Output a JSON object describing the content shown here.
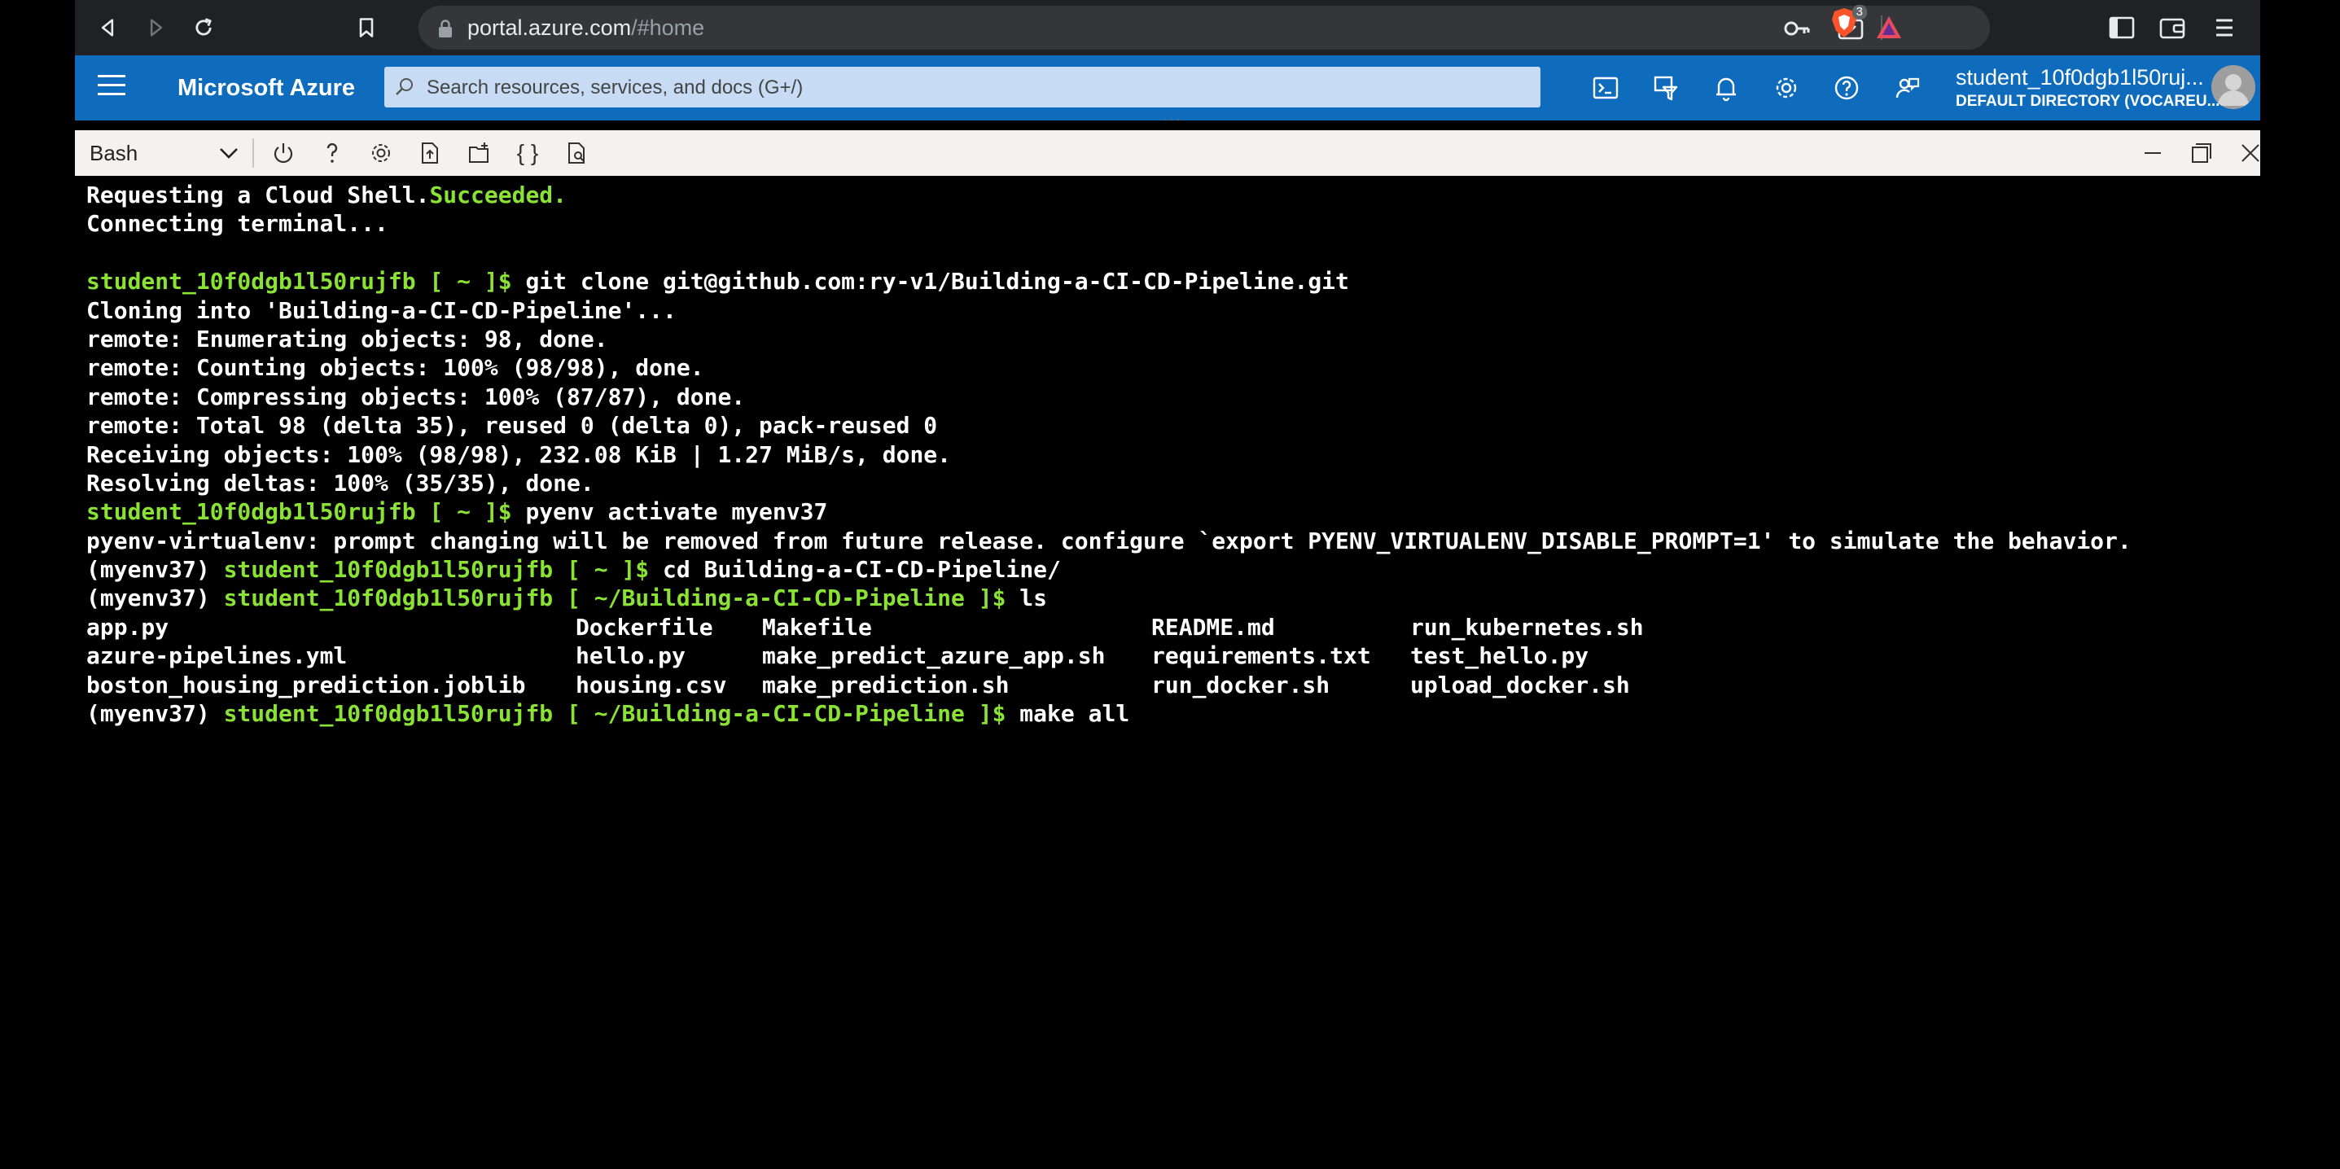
{
  "browser": {
    "url_host": "portal.azure.com",
    "url_path": "/#home",
    "shields_count": "3"
  },
  "header": {
    "brand": "Microsoft Azure",
    "search_placeholder": "Search resources, services, and docs (G+/)",
    "user_name": "student_10f0dgb1l50ruj...",
    "user_directory": "DEFAULT DIRECTORY (VOCAREU..."
  },
  "shell": {
    "selected_shell": "Bash",
    "toolbar_braces": "{ }"
  },
  "terminal": {
    "l1_a": "Requesting a Cloud Shell.",
    "l1_b": "Succeeded.",
    "l2": "Connecting terminal...",
    "prompt_home": "student_10f0dgb1l50rujfb [ ~ ]$",
    "cmd_clone": " git clone git@github.com:ry-v1/Building-a-CI-CD-Pipeline.git",
    "l_cloning": "Cloning into 'Building-a-CI-CD-Pipeline'...",
    "l_enum": "remote: Enumerating objects: 98, done.",
    "l_count": "remote: Counting objects: 100% (98/98), done.",
    "l_compress": "remote: Compressing objects: 100% (87/87), done.",
    "l_total": "remote: Total 98 (delta 35), reused 0 (delta 0), pack-reused 0",
    "l_recv": "Receiving objects: 100% (98/98), 232.08 KiB | 1.27 MiB/s, done.",
    "l_resolve": "Resolving deltas: 100% (35/35), done.",
    "cmd_activate": " pyenv activate myenv37",
    "l_pyenv": "pyenv-virtualenv: prompt changing will be removed from future release. configure `export PYENV_VIRTUALENV_DISABLE_PROMPT=1' to simulate the behavior.",
    "venv": "(myenv37) ",
    "cmd_cd": " cd Building-a-CI-CD-Pipeline/",
    "prompt_repo": "student_10f0dgb1l50rujfb [ ~/Building-a-CI-CD-Pipeline ]$",
    "cmd_ls": " ls",
    "ls_rows": [
      [
        "app.py",
        "Dockerfile",
        "Makefile",
        "README.md",
        "run_kubernetes.sh"
      ],
      [
        "azure-pipelines.yml",
        "hello.py",
        "make_predict_azure_app.sh",
        "requirements.txt",
        "test_hello.py"
      ],
      [
        "boston_housing_prediction.joblib",
        "housing.csv",
        "make_prediction.sh",
        "run_docker.sh",
        "upload_docker.sh"
      ]
    ],
    "cmd_make": " make all"
  },
  "colors": {
    "prompt_green": "#8ae234",
    "azure_blue": "#0f6cbd",
    "browser_dark": "#202124"
  }
}
